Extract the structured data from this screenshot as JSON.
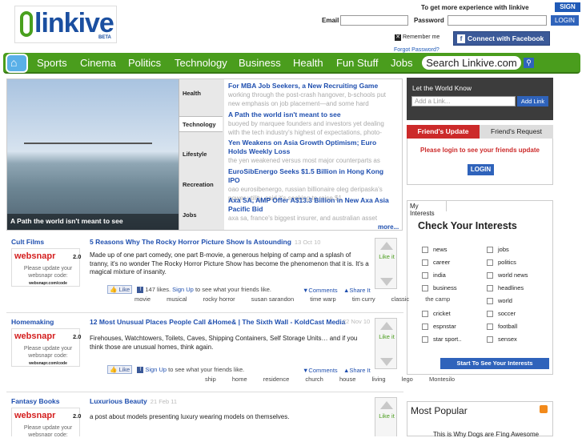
{
  "header": {
    "logo_text": "linkive",
    "logo_beta": "BETA",
    "tagline": "To get more experience with linkive",
    "signup": "SIGN UP",
    "email_label": "Email",
    "password_label": "Password",
    "login": "LOGIN",
    "remember": "Remember me",
    "facebook_connect": "Connect with Facebook",
    "forgot": "Forgot Password?"
  },
  "nav": {
    "items": [
      "Sports",
      "Cinema",
      "Politics",
      "Technology",
      "Business",
      "Health",
      "Fun Stuff",
      "Jobs"
    ],
    "search": "Search Linkive.com"
  },
  "featured": {
    "caption": "A Path the world isn't meant to see",
    "categories": [
      "Health",
      "Technology",
      "Lifestyle",
      "Recreation",
      "Jobs"
    ],
    "stories": [
      {
        "title": "For MBA Job Seekers, a New Recruiting Game",
        "desc": "working through the post-crash hangover, b-schools put new emphasis on job placement—and some hard"
      },
      {
        "title": "A Path the world isn't meant to see",
        "desc": "buoyed by marquee founders and investors yet dealing with the tech industry's highest of expectations, photo-"
      },
      {
        "title": "Yen Weakens on Asia Growth Optimism; Euro Holds Weekly Loss",
        "desc": "the yen weakened versus most major counterparts as"
      },
      {
        "title": "EuroSibEnergo Seeks $1.5 Billion in Hong Kong IPO",
        "desc": "oao eurosibenergo, russian billionaire oleg deripaska's power utility, said it's seeking to raise $1"
      },
      {
        "title": "Axa SA, AMP Offer A$13.3 Billion in New Axa Asia Pacific Bid",
        "desc": "axa sa, france's biggest insurer, and australian asset"
      }
    ],
    "more": "more..."
  },
  "sidebar": {
    "let_world_know": "Let the World Know",
    "add_link_placeholder": "Add a Link...",
    "add_link_button": "Add Link",
    "friends_update": "Friend's Update",
    "friends_request": "Friend's Request",
    "please_login": "Please login to see your friends update",
    "login": "LOGIN",
    "my_interests": "My Interests",
    "check_interests": "Check Your Interests",
    "interests_left": [
      "news",
      "career",
      "india",
      "business",
      "cricket",
      "espnstar",
      "star sport.."
    ],
    "interests_right": [
      "jobs",
      "politics",
      "world news",
      "headlines",
      "world",
      "soccer",
      "football",
      "sensex"
    ],
    "start_button": "Start To See Your Interests",
    "most_popular": "Most Popular",
    "popular_item": "This is Why Dogs are F'ing Awesome"
  },
  "thumb": {
    "brand": "websnapr",
    "version": "2.0",
    "message": "Please update your websnapr code:",
    "code": "websnapr.com/code"
  },
  "posts": [
    {
      "source": "Cult Films",
      "title": "5 Reasons Why The Rocky Horror Picture Show Is Astounding",
      "date": "13 Oct 10",
      "body": "Made up of one part comedy, one part B-movie, a generous helping of camp and a splash of tranny, it's no wonder The Rocky Horror Picture Show has become the phenomenon that it is. It's a magical mixture of insanity.",
      "like_label": "Like",
      "like_count": "147 likes.",
      "signup": "Sign Up",
      "like_text": "to see what your friends like.",
      "comments": "▼Comments",
      "share": "▲Share It",
      "tags": [
        "movie",
        "musical",
        "rocky horror",
        "susan sarandon",
        "time warp",
        "tim curry",
        "classic",
        "the camp"
      ],
      "vote": "Like it"
    },
    {
      "source": "Homemaking",
      "title": "12 Most Unusual Places People Call &Home& | The Sixth Wall - KoldCast Media",
      "date": "22 Nov 10",
      "body": "Firehouses, Watchtowers, Toilets, Caves, Shipping Containers, Self Storage Units… and if you think those are unusual homes, think again.",
      "like_label": "Like",
      "signup": "Sign Up",
      "like_text": "to see what your friends like.",
      "comments": "▼Comments",
      "share": "▲Share It",
      "tags": [
        "ship",
        "home",
        "residence",
        "church",
        "house",
        "living",
        "lego",
        "Montesilo"
      ],
      "vote": "Like it"
    },
    {
      "source": "Fantasy Books",
      "title": "Luxurious Beauty",
      "date": "21 Feb 11",
      "body": "a post about models presenting luxury wearing models on themselves.",
      "vote": "Like it"
    }
  ]
}
